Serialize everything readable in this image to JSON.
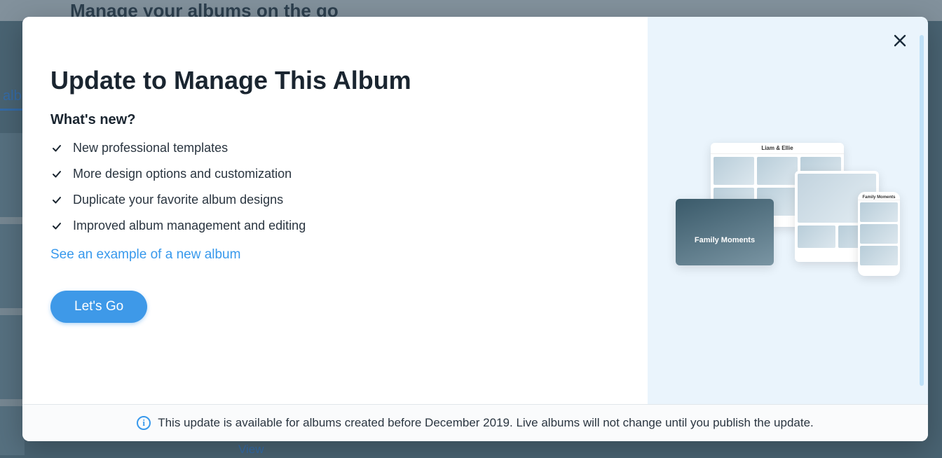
{
  "background": {
    "header": "Manage your albums on the go",
    "tab_partial": "alb",
    "view_link": "View"
  },
  "modal": {
    "title": "Update to Manage This Album",
    "subtitle": "What's new?",
    "features": [
      "New professional templates",
      "More design options and customization",
      "Duplicate your favorite album designs",
      "Improved album management and editing"
    ],
    "example_link": "See an example of a new album",
    "cta": "Let's Go",
    "footer_note": "This update is available for albums created before December 2019. Live albums will not change until you publish the update."
  },
  "illustration": {
    "album_title_1": "Liam & Ellie",
    "card_caption": "Family Moments",
    "phone_title": "Family Moments"
  }
}
